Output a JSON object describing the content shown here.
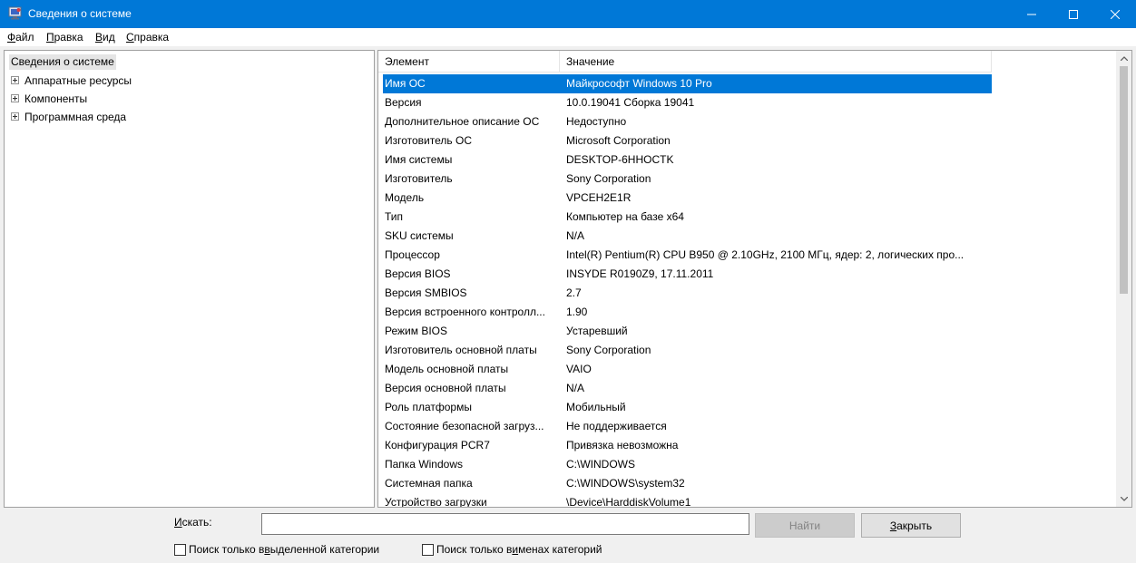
{
  "window": {
    "title": "Сведения о системе",
    "accent_color": "#0078d7"
  },
  "menu": [
    {
      "pre": "",
      "key": "Ф",
      "post": "айл"
    },
    {
      "pre": "",
      "key": "П",
      "post": "равка"
    },
    {
      "pre": "",
      "key": "В",
      "post": "ид"
    },
    {
      "pre": "",
      "key": "С",
      "post": "правка"
    }
  ],
  "tree": {
    "root": "Сведения о системе",
    "nodes": [
      "Аппаратные ресурсы",
      "Компоненты",
      "Программная среда"
    ]
  },
  "list": {
    "columns": [
      "Элемент",
      "Значение"
    ],
    "selected_index": 0,
    "rows": [
      {
        "key": "Имя ОС",
        "value": "Майкрософт Windows 10 Pro"
      },
      {
        "key": "Версия",
        "value": "10.0.19041 Сборка 19041"
      },
      {
        "key": "Дополнительное описание ОС",
        "value": "Недоступно"
      },
      {
        "key": "Изготовитель ОС",
        "value": "Microsoft Corporation"
      },
      {
        "key": "Имя системы",
        "value": "DESKTOP-6HHOCTK"
      },
      {
        "key": "Изготовитель",
        "value": "Sony Corporation"
      },
      {
        "key": "Модель",
        "value": "VPCEH2E1R"
      },
      {
        "key": "Тип",
        "value": "Компьютер на базе x64"
      },
      {
        "key": "SKU системы",
        "value": "N/A"
      },
      {
        "key": "Процессор",
        "value": "Intel(R) Pentium(R) CPU B950 @ 2.10GHz, 2100 МГц, ядер: 2, логических про..."
      },
      {
        "key": "Версия BIOS",
        "value": "INSYDE R0190Z9, 17.11.2011"
      },
      {
        "key": "Версия SMBIOS",
        "value": "2.7"
      },
      {
        "key": "Версия встроенного контролл...",
        "value": "1.90"
      },
      {
        "key": "Режим BIOS",
        "value": "Устаревший"
      },
      {
        "key": "Изготовитель основной платы",
        "value": "Sony Corporation"
      },
      {
        "key": "Модель основной платы",
        "value": "VAIO"
      },
      {
        "key": "Версия основной платы",
        "value": "N/A"
      },
      {
        "key": "Роль платформы",
        "value": "Мобильный"
      },
      {
        "key": "Состояние безопасной загруз...",
        "value": "Не поддерживается"
      },
      {
        "key": "Конфигурация PCR7",
        "value": "Привязка невозможна"
      },
      {
        "key": "Папка Windows",
        "value": "C:\\WINDOWS"
      },
      {
        "key": "Системная папка",
        "value": "C:\\WINDOWS\\system32"
      },
      {
        "key": "Устройство загрузки",
        "value": "\\Device\\HarddiskVolume1"
      }
    ]
  },
  "search": {
    "label_key": "И",
    "label_rest": "скать:",
    "value": "",
    "find_label": "Найти",
    "close_key": "З",
    "close_rest": "акрыть"
  },
  "checkboxes": [
    {
      "pre": "Поиск только в ",
      "key": "в",
      "post": "ыделенной категории",
      "checked": false
    },
    {
      "pre": "Поиск только в ",
      "key": "и",
      "post": "менах категорий",
      "checked": false
    }
  ]
}
